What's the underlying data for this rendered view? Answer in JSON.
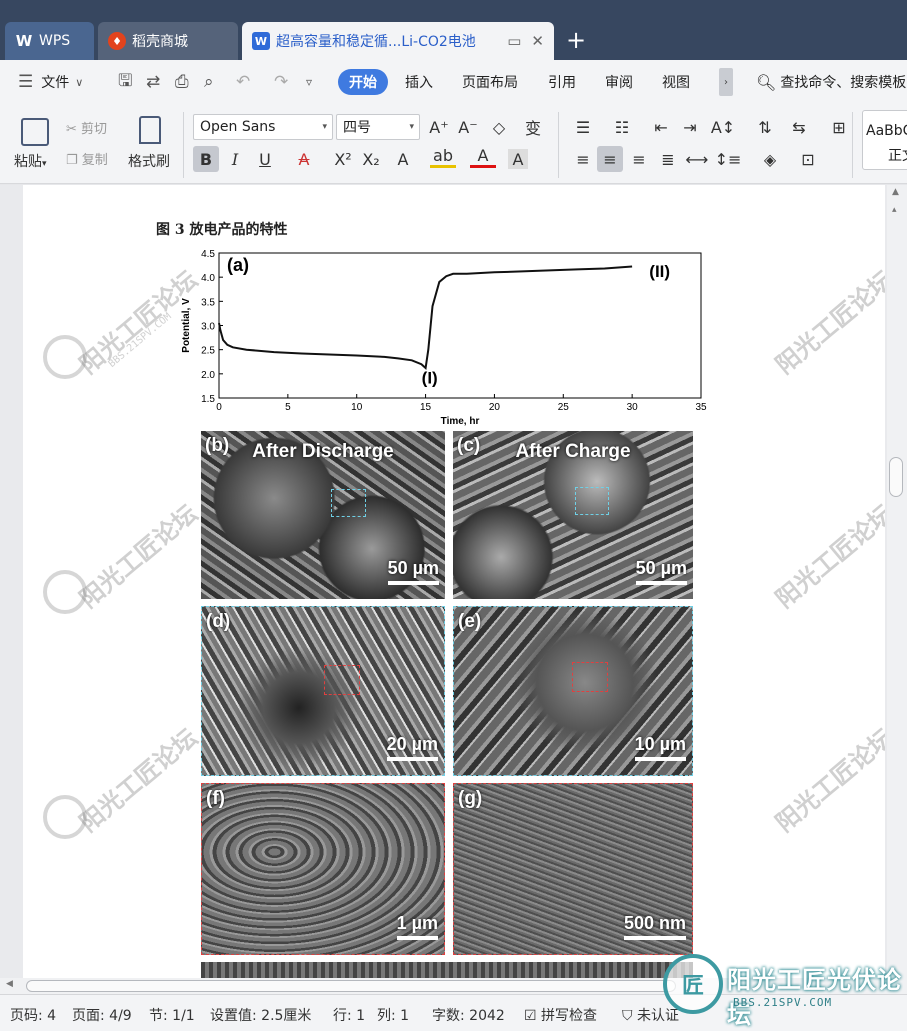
{
  "tabs": [
    {
      "label": "WPS",
      "icon": "wps-logo-icon"
    },
    {
      "label": "稻壳商城",
      "icon": "daoke-icon"
    },
    {
      "label": "超高容量和稳定循...Li-CO2电池",
      "icon": "writer-doc-icon"
    }
  ],
  "menu": {
    "file": "文件",
    "items": [
      "开始",
      "插入",
      "页面布局",
      "引用",
      "审阅",
      "视图"
    ],
    "search": "查找命令、搜索模板"
  },
  "ribbon": {
    "paste": "粘贴",
    "cut": "剪切",
    "copy": "复制",
    "format_painter": "格式刷",
    "font_family": "Open Sans",
    "font_size": "四号",
    "style_preview": "AaBbC",
    "style_name": "正文"
  },
  "document": {
    "caption": "图 3 放电产品的特性",
    "panels": [
      {
        "label": "(b)",
        "title": "After Discharge",
        "scale": "50 µm"
      },
      {
        "label": "(c)",
        "title": "After Charge",
        "scale": "50 µm"
      },
      {
        "label": "(d)",
        "title": "",
        "scale": "20 µm"
      },
      {
        "label": "(e)",
        "title": "",
        "scale": "10 µm"
      },
      {
        "label": "(f)",
        "title": "",
        "scale": "1 µm"
      },
      {
        "label": "(g)",
        "title": "",
        "scale": "500 nm"
      }
    ],
    "watermark": "阳光工匠论坛",
    "watermark_url": "BBS.21SPV.COM"
  },
  "chart_data": {
    "type": "line",
    "panel_label": "(a)",
    "xlabel": "Time, hr",
    "ylabel": "Potential, V",
    "xlim": [
      0,
      35
    ],
    "ylim": [
      1.5,
      4.5
    ],
    "xticks": [
      0,
      5,
      10,
      15,
      20,
      25,
      30,
      35
    ],
    "yticks": [
      1.5,
      2.0,
      2.5,
      3.0,
      3.5,
      4.0,
      4.5
    ],
    "annotations": [
      {
        "text": "(I)",
        "x": 15.3,
        "y": 1.8
      },
      {
        "text": "(II)",
        "x": 32,
        "y": 4.0
      }
    ],
    "series": [
      {
        "x": [
          0,
          0.1,
          0.3,
          0.6,
          1,
          2,
          4,
          6,
          8,
          10,
          12,
          13,
          14,
          14.7,
          15.0,
          15.2,
          15.5,
          16,
          16.5,
          17,
          18,
          20,
          22,
          24,
          26,
          28,
          30
        ],
        "y": [
          3.05,
          2.9,
          2.7,
          2.6,
          2.55,
          2.5,
          2.45,
          2.42,
          2.4,
          2.38,
          2.35,
          2.32,
          2.28,
          2.2,
          2.12,
          2.5,
          3.4,
          3.9,
          4.02,
          4.07,
          4.07,
          4.1,
          4.12,
          4.14,
          4.16,
          4.18,
          4.22
        ],
        "color": "#111111"
      }
    ]
  },
  "status": {
    "page_code": "页码: 4",
    "pages": "页面: 4/9",
    "section": "节: 1/1",
    "setting": "设置值: 2.5厘米",
    "row": "行: 1",
    "col": "列: 1",
    "words": "字数: 2042",
    "spell": "拼写检查",
    "cert": "未认证"
  },
  "brand": {
    "name": "阳光工匠光伏论坛",
    "url": "BBS.21SPV.COM"
  }
}
